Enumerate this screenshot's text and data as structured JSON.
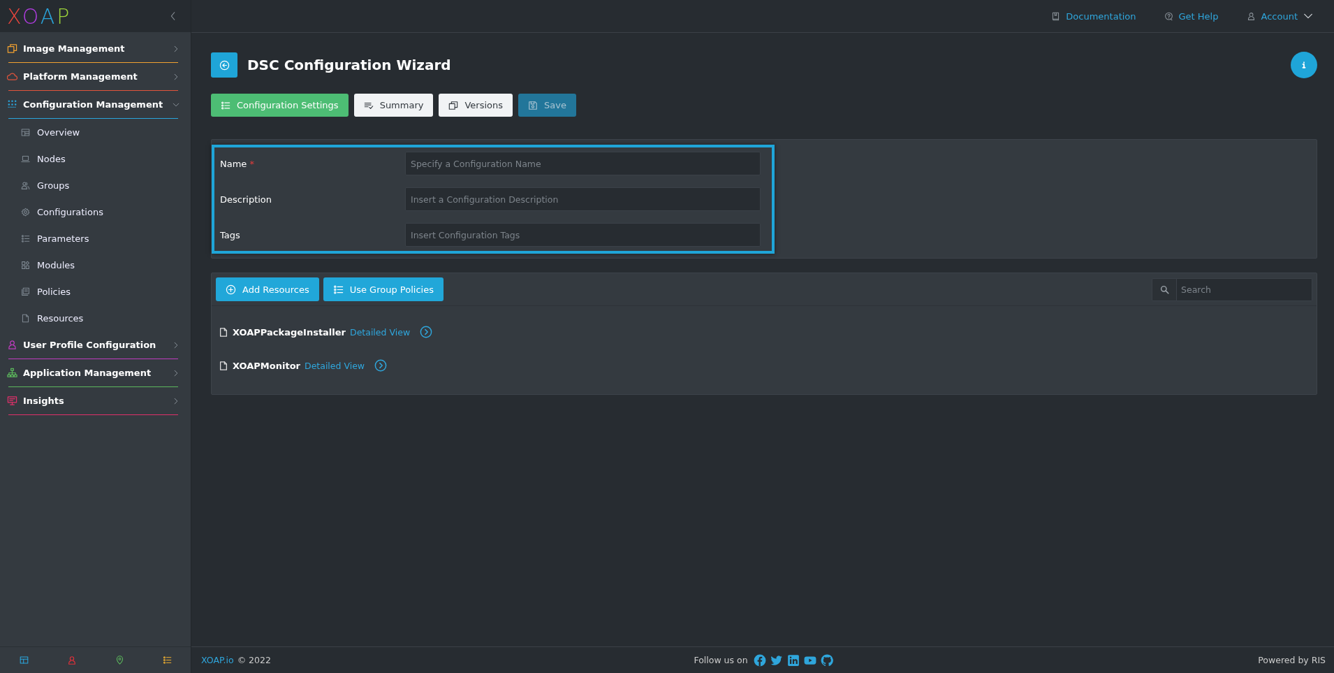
{
  "sidebar": {
    "logo": "XOAP",
    "groups": [
      {
        "label": "Image Management",
        "color": "#f0a030",
        "expanded": false
      },
      {
        "label": "Platform Management",
        "color": "#e0543c",
        "expanded": false
      },
      {
        "label": "Configuration Management",
        "color": "#2aa5dc",
        "expanded": true,
        "children": [
          {
            "label": "Overview"
          },
          {
            "label": "Nodes"
          },
          {
            "label": "Groups"
          },
          {
            "label": "Configurations"
          },
          {
            "label": "Parameters"
          },
          {
            "label": "Modules"
          },
          {
            "label": "Policies"
          },
          {
            "label": "Resources"
          }
        ]
      },
      {
        "label": "User Profile Configuration",
        "color": "#c03cc0",
        "expanded": false
      },
      {
        "label": "Application Management",
        "color": "#5cb85c",
        "expanded": false
      },
      {
        "label": "Insights",
        "color": "#e0306a",
        "expanded": false
      }
    ]
  },
  "header": {
    "links": [
      {
        "label": "Documentation"
      },
      {
        "label": "Get Help"
      },
      {
        "label": "Account"
      }
    ]
  },
  "page": {
    "title": "DSC Configuration Wizard",
    "buttons": [
      {
        "label": "Configuration Settings",
        "kind": "tab",
        "selected": true
      },
      {
        "label": "Summary",
        "kind": "tab",
        "selected": false
      },
      {
        "label": "Versions",
        "kind": "tab",
        "selected": false
      },
      {
        "label": "Save",
        "kind": "save",
        "disabled": true
      }
    ]
  },
  "form": {
    "highlighted": true,
    "fields": [
      {
        "label": "Name",
        "required_mark": "*",
        "placeholder": "Specify a Configuration Name"
      },
      {
        "label": "Description",
        "placeholder": "Insert a Configuration Description"
      },
      {
        "label": "Tags",
        "placeholder": "Insert Configuration Tags"
      }
    ]
  },
  "resources": {
    "buttons": [
      {
        "label": "Add Resources"
      },
      {
        "label": "Use Group Policies"
      }
    ],
    "search": {
      "placeholder": "Search"
    },
    "items": [
      {
        "name": "XOAPPackageInstaller",
        "link": "Detailed View"
      },
      {
        "name": "XOAPMonitor",
        "link": "Detailed View"
      }
    ]
  },
  "footer": {
    "brand": "XOAP.io",
    "copyright": "© 2022",
    "follow": "Follow us on",
    "powered": "Powered by RIS"
  }
}
